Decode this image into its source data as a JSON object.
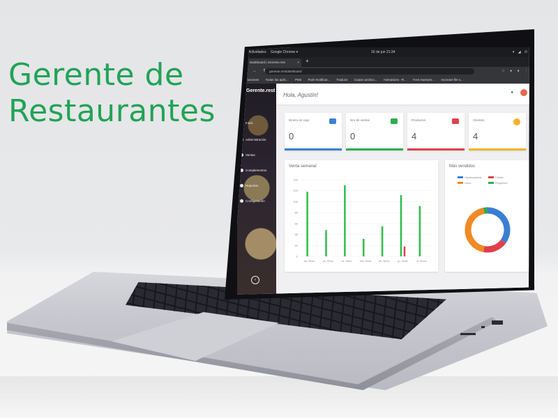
{
  "headline": {
    "line1": "Gerente de",
    "line2": "Restaurantes"
  },
  "os_bar": {
    "activities": "Actividades",
    "browser": "Google Chrome ▾",
    "clock": "16 de jun  21:34"
  },
  "browser": {
    "tab_title": "Dashboard | Gerente.rest",
    "url": "gerente.rest/dashboard",
    "bookmarks": [
      "Aplicaciones",
      "Todas las aplic...",
      "PM2",
      "Push Notificat...",
      "Traducir",
      "Copiar archivo...",
      "Animations - R...",
      "Font Awesom...",
      "Increase file s..."
    ]
  },
  "sidebar": {
    "brand": "Gerente.rest",
    "items": [
      "Inicio",
      "Administración",
      "Ventas",
      "Complementos",
      "Reportes",
      "Configuración"
    ]
  },
  "greeting": "Hola, Agustín!",
  "cards": [
    {
      "label": "Dinero en caja",
      "value": "0",
      "color": "#3b7fd4"
    },
    {
      "label": "Nro de ventas",
      "value": "0",
      "color": "#2dad4f"
    },
    {
      "label": "Productos",
      "value": "4",
      "color": "#e0404a"
    },
    {
      "label": "Clientes",
      "value": "4",
      "color": "#f0b429"
    }
  ],
  "weekly": {
    "title": "Venta semanal",
    "chart_data": {
      "type": "bar",
      "title": "Venta semanal",
      "ylim": [
        0,
        140
      ],
      "y_ticks": [
        "140",
        "120",
        "100",
        "80",
        "60",
        "40",
        "20",
        "0"
      ],
      "categories": [
        "sá, 30/oc",
        "do, 31/oc",
        "lu, 1/nov",
        "ma, 2/nov",
        "mi, 3/nov",
        "ju, 4/nov",
        "vi, 5/nov"
      ],
      "series": [
        {
          "color": "#2dbd4a",
          "values": [
            [
              118,
              0
            ],
            [
              48,
              0
            ],
            [
              130,
              0
            ],
            [
              32,
              0
            ],
            [
              55,
              0
            ],
            [
              112,
              0
            ],
            [
              92,
              0
            ]
          ]
        },
        {
          "color": "#e0404a",
          "values": [
            [
              0,
              0
            ],
            [
              0,
              0
            ],
            [
              0,
              0
            ],
            [
              0,
              0
            ],
            [
              0,
              0
            ],
            [
              0,
              18
            ],
            [
              0,
              0
            ]
          ]
        }
      ]
    }
  },
  "bestsellers": {
    "title": "Más vendidos",
    "chart_data": {
      "type": "pie",
      "title": "Más vendidos",
      "labels": [
        "Hamburguesa",
        "Chivito",
        "Lomo",
        "Pepperoni"
      ],
      "colors": [
        "#3b7fd4",
        "#e0404a",
        "#f08a24",
        "#2dad4f"
      ],
      "values": [
        35,
        18,
        44,
        3
      ]
    }
  }
}
